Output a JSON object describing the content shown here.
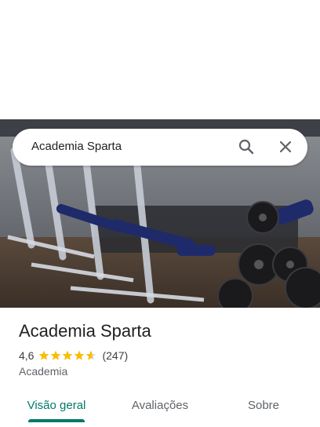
{
  "search": {
    "query": "Academia Sparta"
  },
  "place": {
    "name": "Academia Sparta",
    "rating": "4,6",
    "rating_stars": 4.6,
    "review_count": "(247)",
    "category": "Academia"
  },
  "tabs": [
    {
      "label": "Visão geral",
      "active": true
    },
    {
      "label": "Avaliações",
      "active": false
    },
    {
      "label": "Sobre",
      "active": false
    }
  ],
  "colors": {
    "accent": "#00796b",
    "star": "#fbbc04",
    "text_primary": "#202124",
    "text_secondary": "#5f6368"
  },
  "icons": {
    "search": "search-icon",
    "close": "close-icon",
    "star": "star-icon"
  }
}
